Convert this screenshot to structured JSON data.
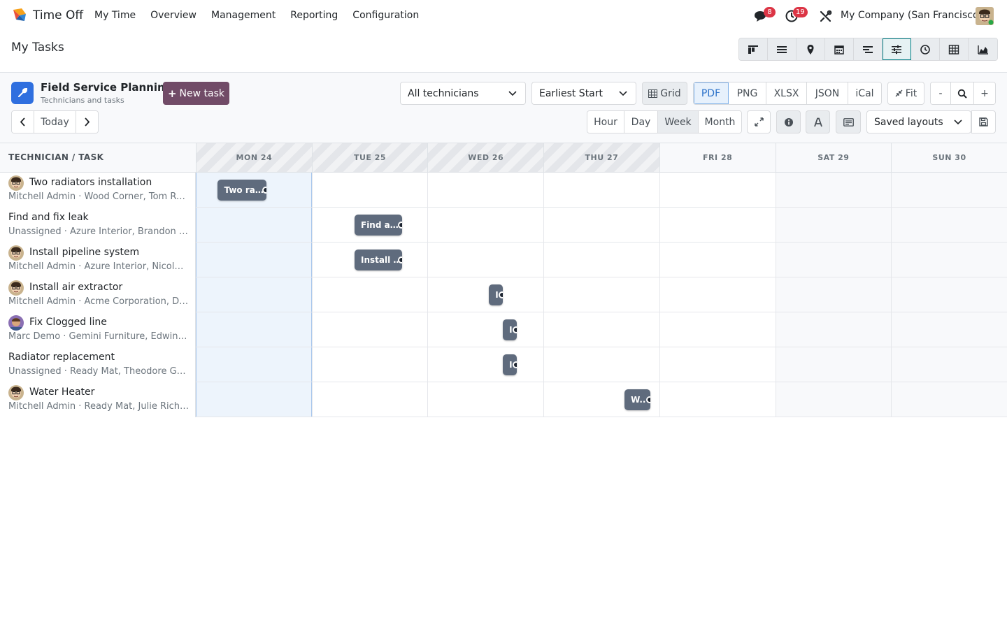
{
  "app": {
    "name": "Time Off",
    "menu": [
      "My Time",
      "Overview",
      "Management",
      "Reporting",
      "Configuration"
    ],
    "messages_badge": "8",
    "activities_badge": "19",
    "company": "My Company (San Francisco)"
  },
  "page": {
    "title": "My Tasks",
    "views": [
      "kanban-icon",
      "list-icon",
      "map-icon",
      "calendar-icon",
      "gantt-icon",
      "planning-icon",
      "activity-icon",
      "pivot-icon",
      "graph-icon"
    ],
    "active_view": 5
  },
  "toolbar": {
    "title": "Field Service Planning",
    "subtitle": "Technicians and tasks",
    "new_task": "New task",
    "technician_filter": "All technicians",
    "sort": "Earliest Start",
    "grid": "Grid",
    "export": [
      "PDF",
      "PNG",
      "XLSX",
      "JSON",
      "iCal"
    ],
    "fit": "Fit",
    "zoom_out": "-",
    "zoom_in": "+",
    "today": "Today",
    "scales": [
      "Hour",
      "Day",
      "Week",
      "Month"
    ],
    "active_scale": "Week",
    "saved_layouts": "Saved layouts",
    "colors": {
      "brand": "#714b67",
      "accent": "#2f6fdf",
      "bar": "#5f6b7d"
    }
  },
  "gantt": {
    "left_header": "TECHNICIAN / TASK",
    "days": [
      "MON 24",
      "TUE 25",
      "WED 26",
      "THU 27",
      "FRI 28",
      "SAT 29",
      "SUN 30"
    ],
    "tasks": [
      {
        "name": "Two radiators installation",
        "meta": "Mitchell Admin · Wood Corner, Tom Ruiz",
        "avatar": "mitchell",
        "bar_label": "Two ra…",
        "start_day": 0.19,
        "duration_days": 0.42
      },
      {
        "name": "Find and fix leak",
        "meta": "Unassigned · Azure Interior, Brandon Freeman",
        "avatar": "",
        "bar_label": "Find a…",
        "start_day": 1.37,
        "duration_days": 0.41
      },
      {
        "name": "Install pipeline system",
        "meta": "Mitchell Admin · Azure Interior, Nicole Ford",
        "avatar": "mitchell",
        "bar_label": "Install …",
        "start_day": 1.37,
        "duration_days": 0.41
      },
      {
        "name": "Install air extractor",
        "meta": "Mitchell Admin · Acme Corporation, Douglas Fletcher",
        "avatar": "mitchell",
        "bar_label": "I",
        "start_day": 2.53,
        "duration_days": 0.12
      },
      {
        "name": "Fix Clogged line",
        "meta": "Marc Demo · Gemini Furniture, Edwin Hansen",
        "avatar": "marc",
        "bar_label": "I",
        "start_day": 2.65,
        "duration_days": 0.12
      },
      {
        "name": "Radiator replacement",
        "meta": "Unassigned · Ready Mat, Theodore Gardner",
        "avatar": "",
        "bar_label": "I",
        "start_day": 2.65,
        "duration_days": 0.12
      },
      {
        "name": "Water Heater",
        "meta": "Mitchell Admin · Ready Mat, Julie Richards",
        "avatar": "mitchell",
        "bar_label": "W..",
        "start_day": 3.7,
        "duration_days": 0.22
      }
    ]
  }
}
